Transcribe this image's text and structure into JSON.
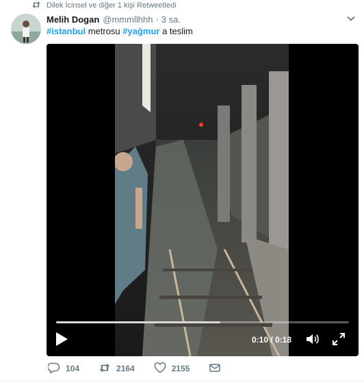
{
  "retweet": {
    "text": "Dilek İcinsel ve diğer 1 kişi Retweetledi",
    "icon": "retweet-icon"
  },
  "tweet": {
    "author_name": "Melih Dogan",
    "author_handle": "@mmmllhhh",
    "separator": "·",
    "time": "3 sa.",
    "text_parts": {
      "hashtag1": "#istanbul",
      "text1": " metrosu ",
      "hashtag2": "#yağmur",
      "text2": " a teslim"
    }
  },
  "video": {
    "time_current": "0:10",
    "time_total": "0:18",
    "time_readout": "0:10 / 0:18",
    "progress": 0.56
  },
  "actions": {
    "reply_count": "104",
    "retweet_count": "2164",
    "like_count": "2155"
  },
  "colors": {
    "link": "#1da1f2",
    "muted": "#657786",
    "text": "#14171a"
  }
}
